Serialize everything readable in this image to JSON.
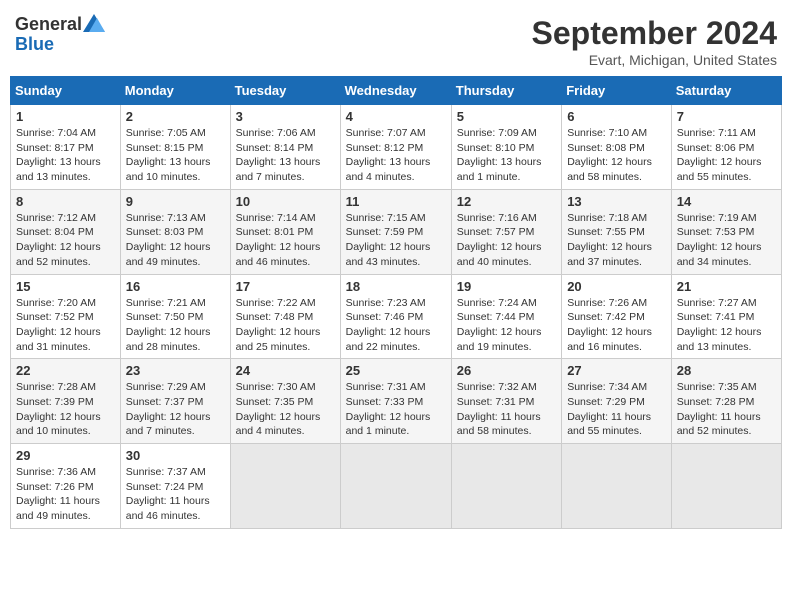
{
  "header": {
    "logo_general": "General",
    "logo_blue": "Blue",
    "month_title": "September 2024",
    "location": "Evart, Michigan, United States"
  },
  "days_of_week": [
    "Sunday",
    "Monday",
    "Tuesday",
    "Wednesday",
    "Thursday",
    "Friday",
    "Saturday"
  ],
  "weeks": [
    [
      {
        "day": "1",
        "sunrise": "7:04 AM",
        "sunset": "8:17 PM",
        "daylight": "13 hours and 13 minutes."
      },
      {
        "day": "2",
        "sunrise": "7:05 AM",
        "sunset": "8:15 PM",
        "daylight": "13 hours and 10 minutes."
      },
      {
        "day": "3",
        "sunrise": "7:06 AM",
        "sunset": "8:14 PM",
        "daylight": "13 hours and 7 minutes."
      },
      {
        "day": "4",
        "sunrise": "7:07 AM",
        "sunset": "8:12 PM",
        "daylight": "13 hours and 4 minutes."
      },
      {
        "day": "5",
        "sunrise": "7:09 AM",
        "sunset": "8:10 PM",
        "daylight": "13 hours and 1 minute."
      },
      {
        "day": "6",
        "sunrise": "7:10 AM",
        "sunset": "8:08 PM",
        "daylight": "12 hours and 58 minutes."
      },
      {
        "day": "7",
        "sunrise": "7:11 AM",
        "sunset": "8:06 PM",
        "daylight": "12 hours and 55 minutes."
      }
    ],
    [
      {
        "day": "8",
        "sunrise": "7:12 AM",
        "sunset": "8:04 PM",
        "daylight": "12 hours and 52 minutes."
      },
      {
        "day": "9",
        "sunrise": "7:13 AM",
        "sunset": "8:03 PM",
        "daylight": "12 hours and 49 minutes."
      },
      {
        "day": "10",
        "sunrise": "7:14 AM",
        "sunset": "8:01 PM",
        "daylight": "12 hours and 46 minutes."
      },
      {
        "day": "11",
        "sunrise": "7:15 AM",
        "sunset": "7:59 PM",
        "daylight": "12 hours and 43 minutes."
      },
      {
        "day": "12",
        "sunrise": "7:16 AM",
        "sunset": "7:57 PM",
        "daylight": "12 hours and 40 minutes."
      },
      {
        "day": "13",
        "sunrise": "7:18 AM",
        "sunset": "7:55 PM",
        "daylight": "12 hours and 37 minutes."
      },
      {
        "day": "14",
        "sunrise": "7:19 AM",
        "sunset": "7:53 PM",
        "daylight": "12 hours and 34 minutes."
      }
    ],
    [
      {
        "day": "15",
        "sunrise": "7:20 AM",
        "sunset": "7:52 PM",
        "daylight": "12 hours and 31 minutes."
      },
      {
        "day": "16",
        "sunrise": "7:21 AM",
        "sunset": "7:50 PM",
        "daylight": "12 hours and 28 minutes."
      },
      {
        "day": "17",
        "sunrise": "7:22 AM",
        "sunset": "7:48 PM",
        "daylight": "12 hours and 25 minutes."
      },
      {
        "day": "18",
        "sunrise": "7:23 AM",
        "sunset": "7:46 PM",
        "daylight": "12 hours and 22 minutes."
      },
      {
        "day": "19",
        "sunrise": "7:24 AM",
        "sunset": "7:44 PM",
        "daylight": "12 hours and 19 minutes."
      },
      {
        "day": "20",
        "sunrise": "7:26 AM",
        "sunset": "7:42 PM",
        "daylight": "12 hours and 16 minutes."
      },
      {
        "day": "21",
        "sunrise": "7:27 AM",
        "sunset": "7:41 PM",
        "daylight": "12 hours and 13 minutes."
      }
    ],
    [
      {
        "day": "22",
        "sunrise": "7:28 AM",
        "sunset": "7:39 PM",
        "daylight": "12 hours and 10 minutes."
      },
      {
        "day": "23",
        "sunrise": "7:29 AM",
        "sunset": "7:37 PM",
        "daylight": "12 hours and 7 minutes."
      },
      {
        "day": "24",
        "sunrise": "7:30 AM",
        "sunset": "7:35 PM",
        "daylight": "12 hours and 4 minutes."
      },
      {
        "day": "25",
        "sunrise": "7:31 AM",
        "sunset": "7:33 PM",
        "daylight": "12 hours and 1 minute."
      },
      {
        "day": "26",
        "sunrise": "7:32 AM",
        "sunset": "7:31 PM",
        "daylight": "11 hours and 58 minutes."
      },
      {
        "day": "27",
        "sunrise": "7:34 AM",
        "sunset": "7:29 PM",
        "daylight": "11 hours and 55 minutes."
      },
      {
        "day": "28",
        "sunrise": "7:35 AM",
        "sunset": "7:28 PM",
        "daylight": "11 hours and 52 minutes."
      }
    ],
    [
      {
        "day": "29",
        "sunrise": "7:36 AM",
        "sunset": "7:26 PM",
        "daylight": "11 hours and 49 minutes."
      },
      {
        "day": "30",
        "sunrise": "7:37 AM",
        "sunset": "7:24 PM",
        "daylight": "11 hours and 46 minutes."
      },
      null,
      null,
      null,
      null,
      null
    ]
  ]
}
